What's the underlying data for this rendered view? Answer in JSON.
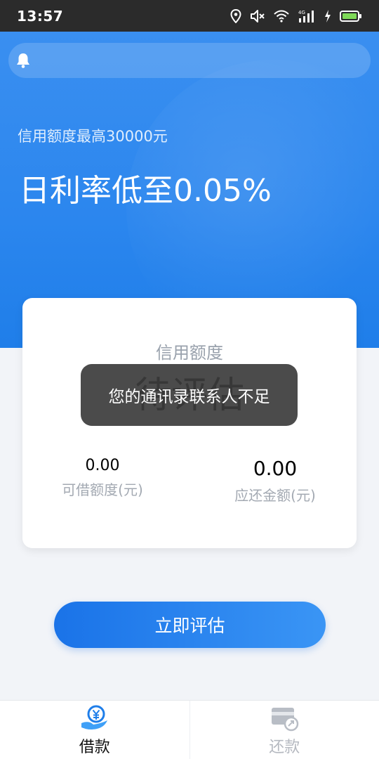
{
  "status_bar": {
    "time": "13:57",
    "icons": [
      "location-icon",
      "mute-icon",
      "wifi-icon",
      "signal-4g-icon",
      "charging-icon",
      "battery-icon"
    ]
  },
  "hero": {
    "subtitle": "信用额度最高30000元",
    "title": "日利率低至0.05%"
  },
  "card": {
    "label": "信用额度",
    "status": "待评估",
    "available": {
      "value": "0.00",
      "label": "可借额度(元)"
    },
    "due": {
      "value": "0.00",
      "label": "应还金额(元)"
    }
  },
  "toast": {
    "message": "您的通讯录联系人不足"
  },
  "cta": {
    "label": "立即评估"
  },
  "tabs": [
    {
      "label": "借款",
      "icon": "borrow-yen-icon",
      "active": true
    },
    {
      "label": "还款",
      "icon": "repay-card-icon",
      "active": false
    }
  ],
  "colors": {
    "brand_blue": "#2b86ee",
    "toast_bg": "#3c3c3c",
    "muted_text": "#9aa2ad"
  }
}
